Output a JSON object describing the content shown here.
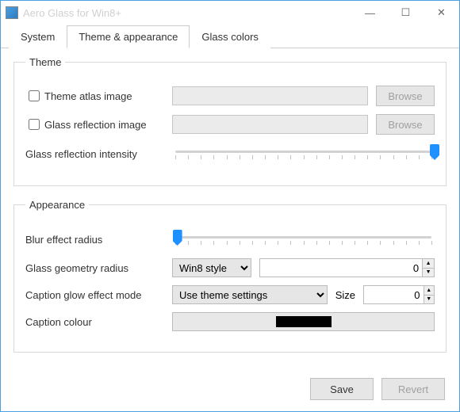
{
  "window": {
    "title": "Aero Glass for Win8+"
  },
  "winbtns": {
    "min": "—",
    "max": "☐",
    "close": "✕"
  },
  "tabs": {
    "system": "System",
    "theme": "Theme & appearance",
    "glass": "Glass colors"
  },
  "theme": {
    "legend": "Theme",
    "atlas_label": "Theme atlas image",
    "reflection_label": "Glass reflection image",
    "intensity_label": "Glass reflection intensity",
    "atlas_value": "",
    "reflection_value": "",
    "browse": "Browse",
    "intensity_pct": 100
  },
  "appearance": {
    "legend": "Appearance",
    "blur_label": "Blur effect radius",
    "blur_pct": 2,
    "geom_label": "Glass geometry radius",
    "geom_options": [
      "Win8 style"
    ],
    "geom_selected": "Win8 style",
    "geom_value": "0",
    "glow_label": "Caption glow effect mode",
    "glow_options": [
      "Use theme settings"
    ],
    "glow_selected": "Use theme settings",
    "size_label": "Size",
    "size_value": "0",
    "colour_label": "Caption colour",
    "colour_hex": "#000000"
  },
  "footer": {
    "save": "Save",
    "revert": "Revert"
  }
}
